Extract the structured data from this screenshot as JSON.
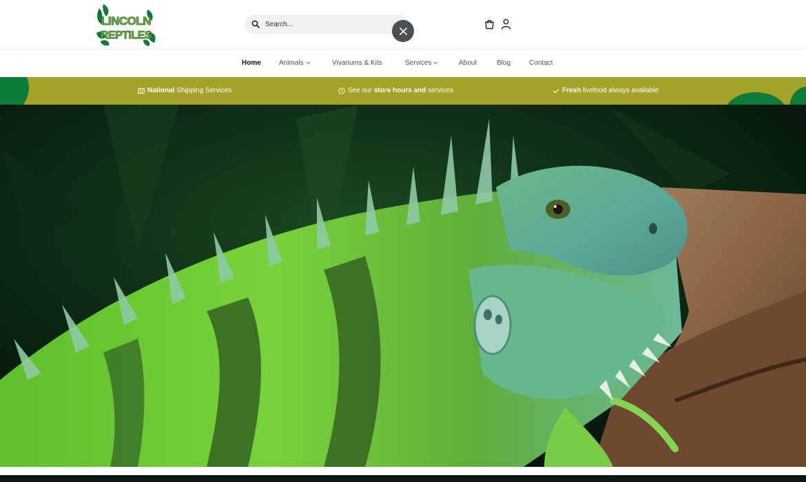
{
  "brand": {
    "line1": "LINCOLN",
    "line2": "REPTILES",
    "primary_color": "#0e7a3a",
    "accent_color": "#a5a22a"
  },
  "search": {
    "placeholder": "Search...",
    "value": ""
  },
  "icons": {
    "search": "search-icon",
    "close": "close-icon",
    "cart": "cart-icon",
    "account": "user-icon"
  },
  "nav": {
    "items": [
      {
        "label": "Home",
        "active": true,
        "dropdown": false
      },
      {
        "label": "Animals",
        "active": false,
        "dropdown": true
      },
      {
        "label": "Vivariums & Kits",
        "active": false,
        "dropdown": false
      },
      {
        "label": "Services",
        "active": false,
        "dropdown": true
      },
      {
        "label": "About",
        "active": false,
        "dropdown": false
      },
      {
        "label": "Blog",
        "active": false,
        "dropdown": false
      },
      {
        "label": "Contact",
        "active": false,
        "dropdown": false
      }
    ]
  },
  "promo": {
    "items": [
      {
        "bold": "National",
        "text": " Shipping Services",
        "icon": "map-icon"
      },
      {
        "pre": "See our ",
        "bold": "store hours and",
        "text": " services",
        "icon": "clock-icon"
      },
      {
        "bold": "Fresh",
        "text": " livefood always available",
        "icon": "check-icon"
      }
    ]
  }
}
